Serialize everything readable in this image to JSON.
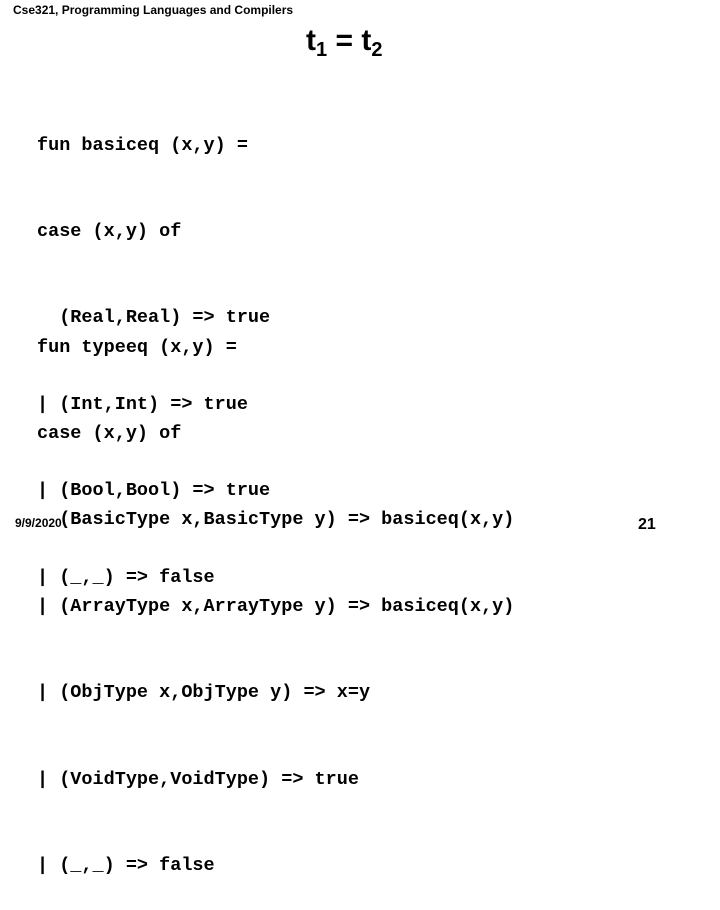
{
  "header": {
    "course": "Cse321, Programming Languages and Compilers"
  },
  "title": {
    "lhs": "t",
    "lhs_sub": "1",
    "op": " = ",
    "rhs": "t",
    "rhs_sub": "2"
  },
  "code_block_1": {
    "lines": [
      "fun basiceq (x,y) =",
      "case (x,y) of",
      "  (Real,Real) => true",
      "| (Int,Int) => true",
      "| (Bool,Bool) => true",
      "| (_,_) => false"
    ]
  },
  "code_block_2": {
    "lines": [
      "fun typeeq (x,y) =",
      "case (x,y) of",
      "  (BasicType x,BasicType y) => basiceq(x,y)",
      "| (ArrayType x,ArrayType y) => basiceq(x,y)",
      "| (ObjType x,ObjType y) => x=y",
      "| (VoidType,VoidType) => true",
      "| (_,_) => false"
    ]
  },
  "footer": {
    "date": "9/9/2020",
    "page_number": "21"
  }
}
